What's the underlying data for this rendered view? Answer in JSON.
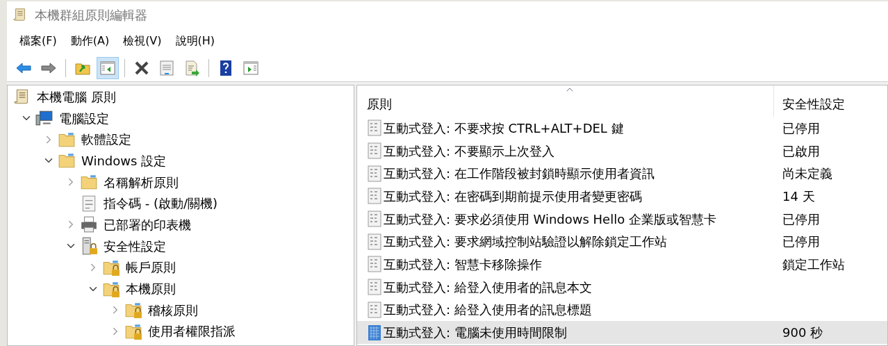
{
  "window": {
    "title": "本機群組原則編輯器"
  },
  "menu": [
    "檔案(F)",
    "動作(A)",
    "檢視(V)",
    "說明(H)"
  ],
  "toolbar": [
    {
      "kind": "back",
      "pressed": false
    },
    {
      "kind": "forward",
      "pressed": false
    },
    {
      "kind": "sep"
    },
    {
      "kind": "up",
      "pressed": false
    },
    {
      "kind": "tree",
      "pressed": true
    },
    {
      "kind": "sep"
    },
    {
      "kind": "delete",
      "pressed": false
    },
    {
      "kind": "properties",
      "pressed": false
    },
    {
      "kind": "export",
      "pressed": false
    },
    {
      "kind": "sep"
    },
    {
      "kind": "help",
      "pressed": false
    },
    {
      "kind": "action",
      "pressed": false
    }
  ],
  "tree": {
    "label": "本機電腦 原則",
    "kind": "policy",
    "children": [
      {
        "label": "電腦設定",
        "kind": "computer",
        "expandable": true,
        "expanded": true,
        "children": [
          {
            "label": "軟體設定",
            "kind": "folder",
            "expandable": true,
            "expanded": false
          },
          {
            "label": "Windows 設定",
            "kind": "folder",
            "expandable": true,
            "expanded": true,
            "children": [
              {
                "label": "名稱解析原則",
                "kind": "folder",
                "expandable": true,
                "expanded": false
              },
              {
                "label": "指令碼 - (啟動/關機)",
                "kind": "script",
                "expandable": false
              },
              {
                "label": "已部署的印表機",
                "kind": "printer",
                "expandable": true,
                "expanded": false
              },
              {
                "label": "安全性設定",
                "kind": "security",
                "expandable": true,
                "expanded": true,
                "children": [
                  {
                    "label": "帳戶原則",
                    "kind": "lockfolder",
                    "expandable": true,
                    "expanded": false
                  },
                  {
                    "label": "本機原則",
                    "kind": "lockfolder",
                    "expandable": true,
                    "expanded": true,
                    "children": [
                      {
                        "label": "稽核原則",
                        "kind": "lockfolder",
                        "expandable": true,
                        "expanded": false
                      },
                      {
                        "label": "使用者權限指派",
                        "kind": "lockfolder",
                        "expandable": true,
                        "expanded": false
                      }
                    ]
                  }
                ]
              }
            ]
          }
        ]
      }
    ]
  },
  "list": {
    "columns": [
      "原則",
      "安全性設定"
    ],
    "rows": [
      {
        "policy": "互動式登入: 不要求按 CTRL+ALT+DEL 鍵",
        "setting": "已停用",
        "selected": false
      },
      {
        "policy": "互動式登入: 不要顯示上次登入",
        "setting": "已啟用",
        "selected": false
      },
      {
        "policy": "互動式登入: 在工作階段被封鎖時顯示使用者資訊",
        "setting": "尚未定義",
        "selected": false
      },
      {
        "policy": "互動式登入: 在密碼到期前提示使用者變更密碼",
        "setting": "14 天",
        "selected": false
      },
      {
        "policy": "互動式登入: 要求必須使用 Windows Hello 企業版或智慧卡",
        "setting": "已停用",
        "selected": false
      },
      {
        "policy": "互動式登入: 要求網域控制站驗證以解除鎖定工作站",
        "setting": "已停用",
        "selected": false
      },
      {
        "policy": "互動式登入: 智慧卡移除操作",
        "setting": "鎖定工作站",
        "selected": false
      },
      {
        "policy": "互動式登入: 給登入使用者的訊息本文",
        "selected": false
      },
      {
        "policy": "互動式登入: 給登入使用者的訊息標題",
        "selected": false
      },
      {
        "policy": "互動式登入: 電腦未使用時間限制",
        "setting": "900 秒",
        "selected": true
      }
    ]
  }
}
